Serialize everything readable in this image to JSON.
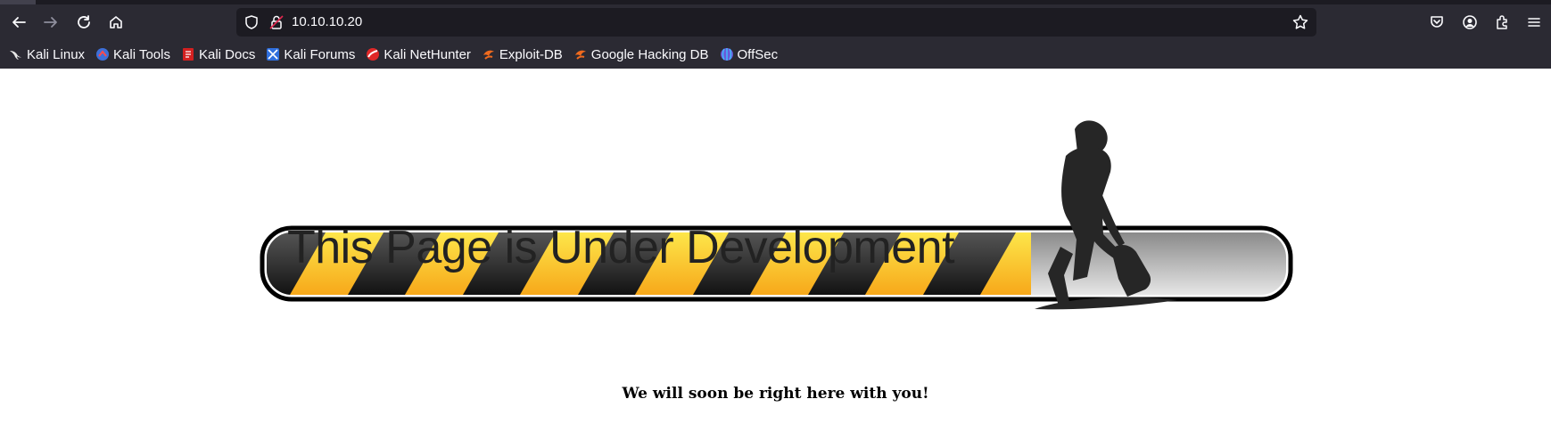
{
  "browser": {
    "url": "10.10.10.20",
    "bookmarks": [
      {
        "label": "Kali Linux",
        "icon": "kali-dragon-icon"
      },
      {
        "label": "Kali Tools",
        "icon": "kali-tools-icon"
      },
      {
        "label": "Kali Docs",
        "icon": "kali-docs-icon"
      },
      {
        "label": "Kali Forums",
        "icon": "kali-forums-icon"
      },
      {
        "label": "Kali NetHunter",
        "icon": "kali-nethunter-icon"
      },
      {
        "label": "Exploit-DB",
        "icon": "exploit-db-icon"
      },
      {
        "label": "Google Hacking DB",
        "icon": "google-hacking-db-icon"
      },
      {
        "label": "OffSec",
        "icon": "offsec-icon"
      }
    ],
    "colors": {
      "chrome": "#2b2a33",
      "urlbar": "#1c1b22",
      "text": "#fbfbfe"
    }
  },
  "page": {
    "heading": "This Page is Under Development",
    "tagline": "We will soon be right here with you!",
    "progress": 0.75,
    "colors": {
      "stripe_yellow": "#f5c21b",
      "stripe_dark": "#2a2a2a",
      "heading": "#222222"
    }
  }
}
